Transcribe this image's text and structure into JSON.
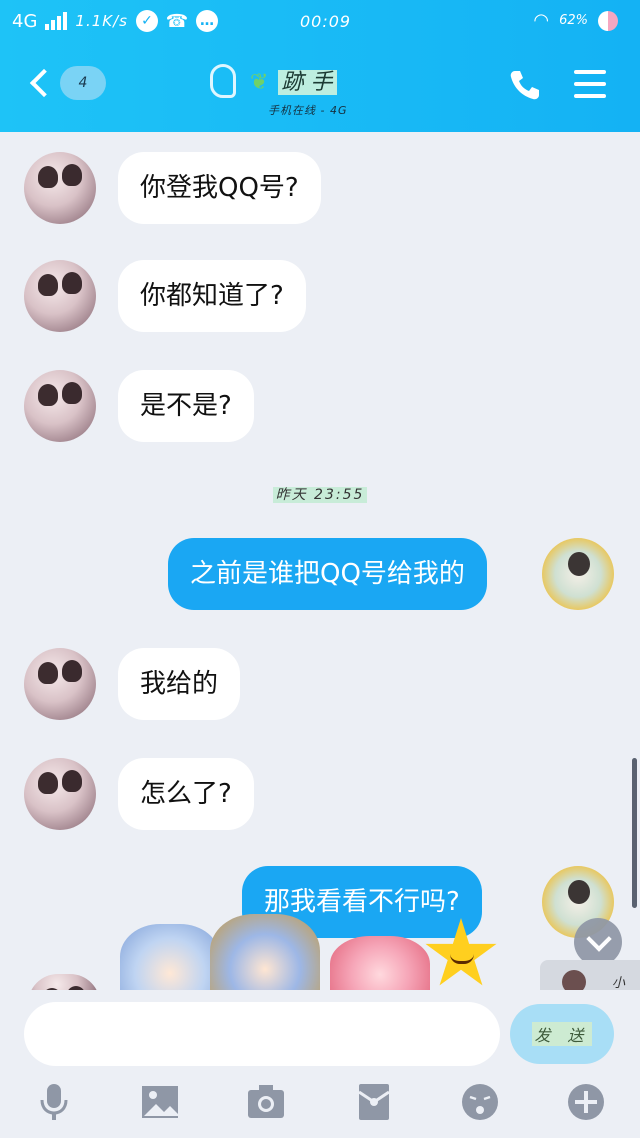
{
  "status_bar": {
    "network": "4G",
    "speed": "1.1K/s",
    "time": "00:09",
    "battery": "62%"
  },
  "header": {
    "unread_count": "4",
    "contact_name": "跡 手",
    "contact_status": "手机在线 - 4G"
  },
  "messages": [
    {
      "from": "them",
      "text": "你登我QQ号?"
    },
    {
      "from": "them",
      "text": "你都知道了?"
    },
    {
      "from": "them",
      "text": "是不是?"
    },
    {
      "type": "time",
      "text": "昨天 23:55"
    },
    {
      "from": "me",
      "text": "之前是谁把QQ号给我的"
    },
    {
      "from": "them",
      "text": "我给的"
    },
    {
      "from": "them",
      "text": "怎么了?"
    },
    {
      "from": "me",
      "text": "那我看看不行吗?"
    }
  ],
  "mini_card": {
    "text": "小 丽"
  },
  "composer": {
    "placeholder": "",
    "send_label": "发 送"
  },
  "colors": {
    "header": "#14b2f4",
    "my_bubble": "#1aa7f3",
    "their_bubble": "#ffffff",
    "background": "#eceff5"
  },
  "icons": [
    "mic-icon",
    "image-icon",
    "camera-icon",
    "red-packet-icon",
    "emoji-icon",
    "plus-icon"
  ]
}
